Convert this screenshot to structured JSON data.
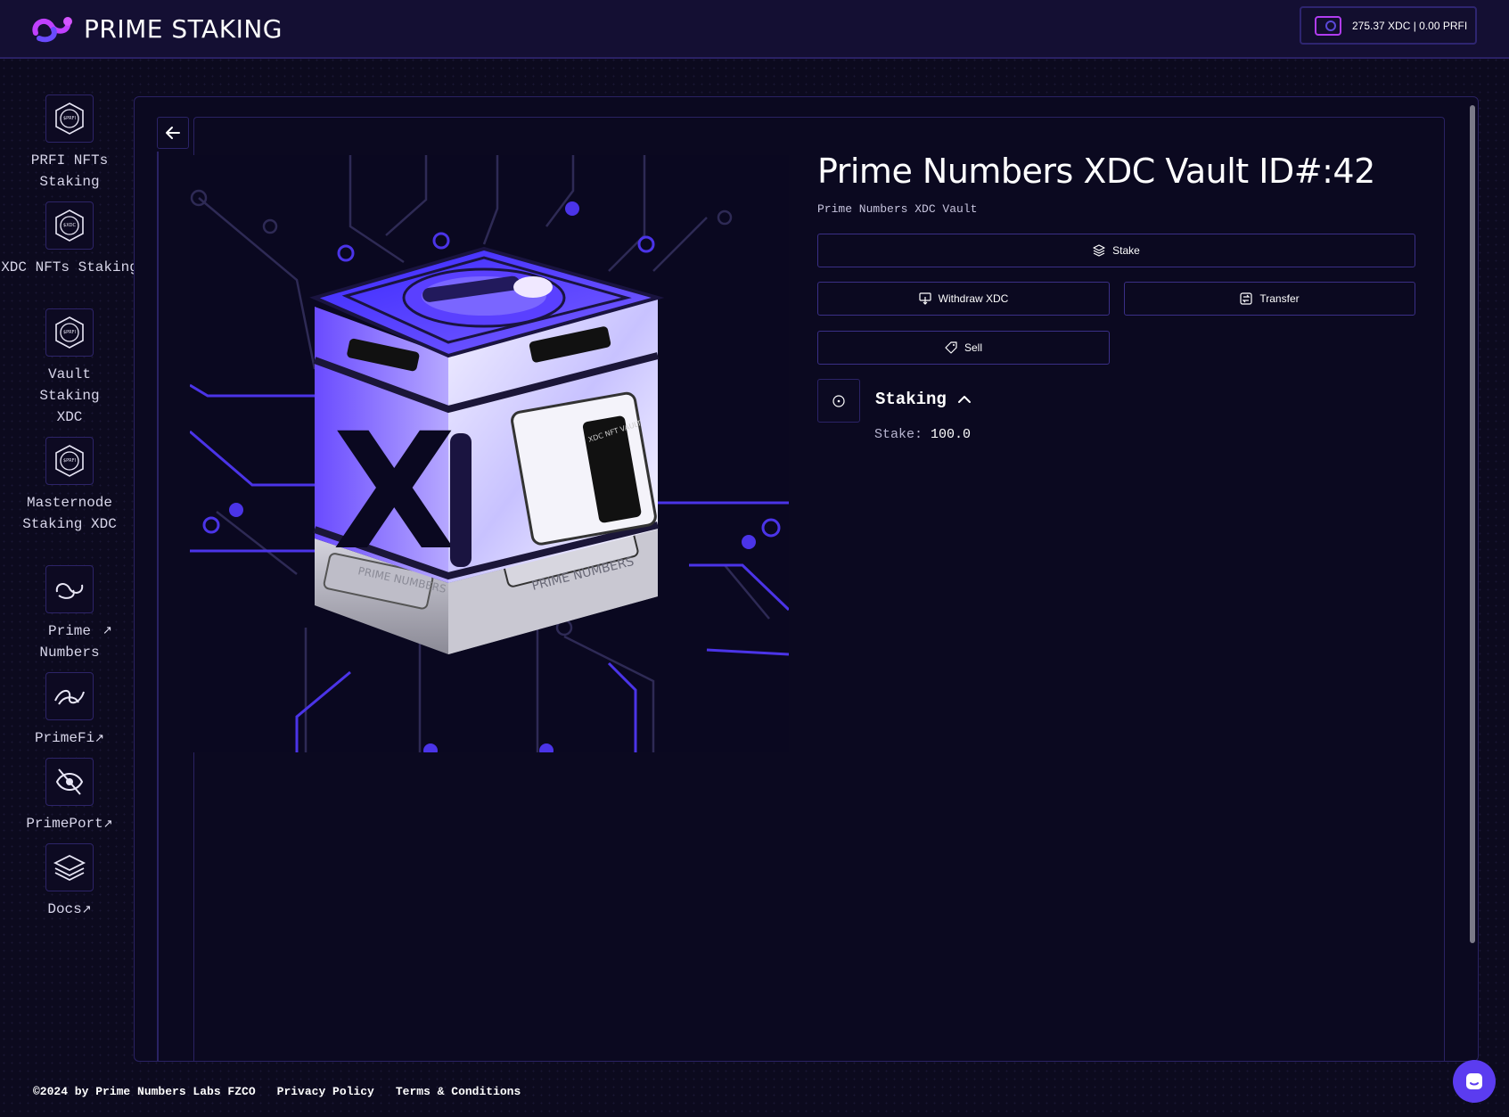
{
  "header": {
    "brand": "PRIME STAKING",
    "wallet_balance": "275.37 XDC | 0.00 PRFI"
  },
  "sidebar": {
    "items": [
      {
        "label": "PRFI NFTs Staking",
        "icon_text": "$PRFI",
        "icon": "prfi-coin-icon",
        "external": false
      },
      {
        "label": "XDC NFTs Staking",
        "icon_text": "$XDC",
        "icon": "xdc-coin-icon",
        "external": false
      },
      {
        "label": "Vault Staking XDC",
        "icon_text": "$PRFI",
        "icon": "prfi-coin-icon",
        "external": false
      },
      {
        "label": "Masternode Staking XDC",
        "icon_text": "$PRFI",
        "icon": "prfi-coin-icon",
        "external": false
      },
      {
        "label": "Prime Numbers",
        "icon": "prime-numbers-logo-icon",
        "external": true
      },
      {
        "label": "PrimeFi",
        "icon": "primefi-logo-icon",
        "external": true
      },
      {
        "label": "PrimePort",
        "icon": "primeport-logo-icon",
        "external": true
      },
      {
        "label": "Docs",
        "icon": "docs-stack-icon",
        "external": true
      }
    ],
    "external_glyph": "↗"
  },
  "vault": {
    "title": "Prime Numbers XDC Vault ID#:42",
    "subtitle": "Prime Numbers XDC Vault",
    "image_labels": {
      "front": "XDC NFT VAULT",
      "base": "PRIME NUMBERS",
      "letter": "X"
    }
  },
  "actions": {
    "stake": "Stake",
    "withdraw": "Withdraw XDC",
    "transfer": "Transfer",
    "sell": "Sell"
  },
  "staking": {
    "title": "Staking",
    "stake_label": "Stake:",
    "stake_value": "100.0"
  },
  "footer": {
    "copyright": "©2024 by Prime Numbers Labs FZCO",
    "privacy": "Privacy Policy",
    "terms": "Terms & Conditions"
  },
  "colors": {
    "background": "#0c0a1e",
    "accent": "#5b3cf0",
    "border": "#2a2263"
  }
}
